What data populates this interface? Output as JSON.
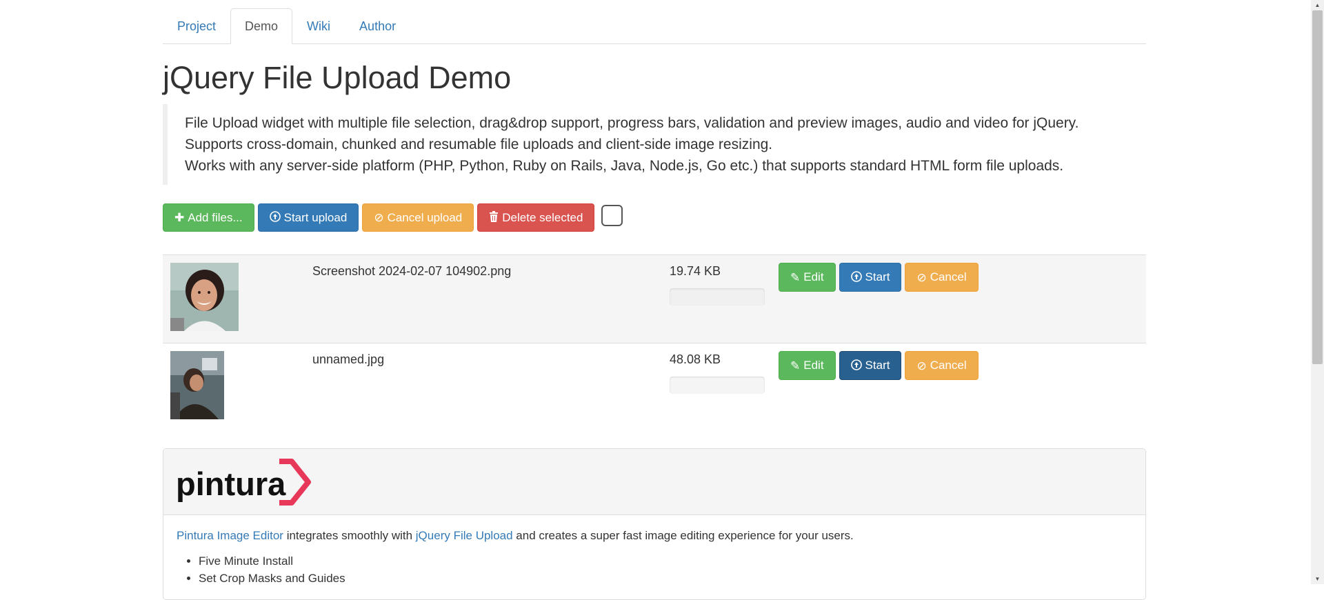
{
  "tabs": [
    {
      "label": "Project",
      "active": false
    },
    {
      "label": "Demo",
      "active": true
    },
    {
      "label": "Wiki",
      "active": false
    },
    {
      "label": "Author",
      "active": false
    }
  ],
  "page_title": "jQuery File Upload Demo",
  "description": [
    "File Upload widget with multiple file selection, drag&drop support, progress bars, validation and preview images, audio and video for jQuery.",
    "Supports cross-domain, chunked and resumable file uploads and client-side image resizing.",
    "Works with any server-side platform (PHP, Python, Ruby on Rails, Java, Node.js, Go etc.) that supports standard HTML form file uploads."
  ],
  "toolbar": {
    "add_files": "Add files...",
    "start_upload": "Start upload",
    "cancel_upload": "Cancel upload",
    "delete_selected": "Delete selected"
  },
  "files": [
    {
      "name": "Screenshot 2024-02-07 104902.png",
      "size": "19.74 KB",
      "progress": 0,
      "edit": "Edit",
      "start": "Start",
      "cancel": "Cancel"
    },
    {
      "name": "unnamed.jpg",
      "size": "48.08 KB",
      "progress": 0,
      "edit": "Edit",
      "start": "Start",
      "cancel": "Cancel"
    }
  ],
  "promo": {
    "logo_text": "pintura",
    "link1": "Pintura Image Editor",
    "text1": " integrates smoothly with ",
    "link2": "jQuery File Upload",
    "text2": " and creates a super fast image editing experience for your users.",
    "features": [
      "Five Minute Install",
      "Set Crop Masks and Guides"
    ]
  },
  "colors": {
    "success": "#5cb85c",
    "primary": "#337ab7",
    "warning": "#f0ad4e",
    "danger": "#d9534f",
    "link": "#337ab7",
    "logo_accent": "#e8385a"
  }
}
